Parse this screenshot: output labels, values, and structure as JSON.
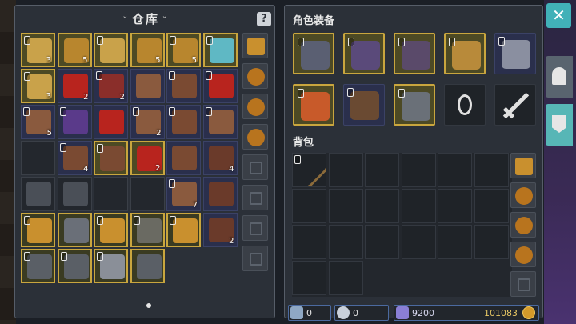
{
  "warehouse": {
    "title": "仓库",
    "title_decor_left": "ˇ",
    "title_decor_right": "ˇ",
    "help_icon": "?",
    "grid": [
      [
        {
          "icon": "scroll",
          "frame": "gold",
          "lock": true,
          "count": "3"
        },
        {
          "icon": "scroll-book",
          "frame": "gold",
          "lock": false,
          "count": "5"
        },
        {
          "icon": "scroll",
          "frame": "gold",
          "lock": true,
          "count": ""
        },
        {
          "icon": "scroll-book",
          "frame": "gold",
          "lock": false,
          "count": "5"
        },
        {
          "icon": "scroll-book",
          "frame": "gold",
          "lock": true,
          "count": "5"
        },
        {
          "icon": "crystal-blue",
          "frame": "gold",
          "lock": true,
          "count": ""
        }
      ],
      [
        {
          "icon": "scroll",
          "frame": "gold",
          "lock": true,
          "count": "3"
        },
        {
          "icon": "red-gem",
          "frame": "blue",
          "lock": false,
          "count": "2"
        },
        {
          "icon": "red-ore",
          "frame": "blue",
          "lock": true,
          "count": "2"
        },
        {
          "icon": "leaf-brown",
          "frame": "blue",
          "lock": false,
          "count": ""
        },
        {
          "icon": "hide-brown",
          "frame": "blue",
          "lock": true,
          "count": ""
        },
        {
          "icon": "red-gem",
          "frame": "blue",
          "lock": true,
          "count": ""
        }
      ],
      [
        {
          "icon": "leaf-brown",
          "frame": "blue",
          "lock": true,
          "count": "5"
        },
        {
          "icon": "purple-ore",
          "frame": "blue",
          "lock": true,
          "count": ""
        },
        {
          "icon": "red-gem",
          "frame": "blue",
          "lock": false,
          "count": ""
        },
        {
          "icon": "leaf-brown",
          "frame": "blue",
          "lock": true,
          "count": "2"
        },
        {
          "icon": "hide-brown",
          "frame": "blue",
          "lock": true,
          "count": ""
        },
        {
          "icon": "leaf-brown",
          "frame": "blue",
          "lock": true,
          "count": ""
        }
      ],
      [
        {
          "icon": "",
          "frame": "empty",
          "lock": false,
          "count": ""
        },
        {
          "icon": "hide-brown",
          "frame": "blue",
          "lock": true,
          "count": "4"
        },
        {
          "icon": "hide-brown",
          "frame": "gold",
          "lock": true,
          "count": ""
        },
        {
          "icon": "red-gem",
          "frame": "gold",
          "lock": false,
          "count": "2"
        },
        {
          "icon": "hide-brown",
          "frame": "blue",
          "lock": false,
          "count": ""
        },
        {
          "icon": "claw-brown",
          "frame": "blue",
          "lock": false,
          "count": "4"
        }
      ],
      [
        {
          "icon": "armor-dark",
          "frame": "empty",
          "lock": false,
          "count": ""
        },
        {
          "icon": "armor-dark",
          "frame": "empty",
          "lock": false,
          "count": ""
        },
        {
          "icon": "",
          "frame": "empty",
          "lock": false,
          "count": ""
        },
        {
          "icon": "",
          "frame": "empty",
          "lock": false,
          "count": ""
        },
        {
          "icon": "leaf-brown",
          "frame": "blue",
          "lock": true,
          "count": "7"
        },
        {
          "icon": "claw-brown",
          "frame": "blue",
          "lock": false,
          "count": ""
        }
      ],
      [
        {
          "icon": "amulet-gold",
          "frame": "olive",
          "lock": true,
          "count": ""
        },
        {
          "icon": "spear",
          "frame": "olive",
          "lock": false,
          "count": ""
        },
        {
          "icon": "amulet-gold",
          "frame": "olive",
          "lock": true,
          "count": ""
        },
        {
          "icon": "gauntlet",
          "frame": "olive",
          "lock": true,
          "count": ""
        },
        {
          "icon": "amulet-gold",
          "frame": "olive",
          "lock": true,
          "count": ""
        },
        {
          "icon": "claw-brown",
          "frame": "blue",
          "lock": false,
          "count": "2"
        }
      ],
      [
        {
          "icon": "bow",
          "frame": "olive",
          "lock": true,
          "count": ""
        },
        {
          "icon": "gauntlet-dark",
          "frame": "olive",
          "lock": true,
          "count": ""
        },
        {
          "icon": "dagger",
          "frame": "olive",
          "lock": true,
          "count": ""
        },
        {
          "icon": "bow",
          "frame": "olive",
          "lock": false,
          "count": ""
        },
        {
          "icon": "",
          "frame": "none",
          "lock": false,
          "count": ""
        },
        {
          "icon": "",
          "frame": "none",
          "lock": false,
          "count": ""
        }
      ]
    ],
    "side_tabs": [
      "backpack-gold-icon",
      "pouch-icon",
      "pouch-icon",
      "pouch-icon",
      "empty-slot-icon",
      "empty-slot-icon",
      "empty-slot-icon",
      "empty-slot-icon"
    ]
  },
  "equipment": {
    "title": "角色装备",
    "slots": [
      {
        "icon": "helmet",
        "frame": "gold",
        "lock": true
      },
      {
        "icon": "hood-purple",
        "frame": "gold",
        "lock": true
      },
      {
        "icon": "armor-purple",
        "frame": "gold",
        "lock": true
      },
      {
        "icon": "ring-gold",
        "frame": "gold",
        "lock": true
      },
      {
        "icon": "mace",
        "frame": "blue",
        "lock": true
      },
      {
        "icon": "amulet-red",
        "frame": "gold",
        "lock": true
      },
      {
        "icon": "glove-brown",
        "frame": "blue",
        "lock": true
      },
      {
        "icon": "boots-steel",
        "frame": "gold",
        "lock": true
      },
      {
        "icon": "ring-outline",
        "frame": "empty",
        "lock": false
      },
      {
        "icon": "sword-outline",
        "frame": "empty",
        "lock": false
      }
    ]
  },
  "backpack": {
    "title": "背包",
    "first_item": "torch"
  },
  "currency": {
    "keys": "0",
    "potions": "0",
    "gems": "9200",
    "gold": "101083"
  },
  "colors": {
    "accent": "#41b1b8",
    "gold_frame": "#c9a63e",
    "blue_frame": "#3b4266"
  }
}
